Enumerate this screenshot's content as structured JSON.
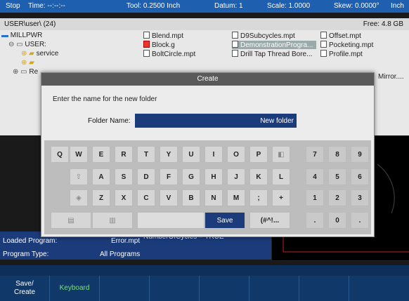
{
  "status": {
    "state": "Stop",
    "time": "Time: --:--:--",
    "tool": "Tool: 0.2500 Inch",
    "datum": "Datum: 1",
    "scale": "Scale: 1.0000",
    "skew": "Skew: 0.0000°",
    "units": "Inch"
  },
  "pathbar": {
    "path": "USER\\user\\ (24)",
    "free": "Free: 4.8 GB"
  },
  "tree": {
    "root": "MILLPWR",
    "user": "USER:",
    "service": "service",
    "re": "Re"
  },
  "files": {
    "col1": [
      "Blend.mpt",
      "Block.g",
      "BoltCircle.mpt"
    ],
    "col2": [
      "D9Subcycles.mpt",
      "DemonstrationProgra...",
      "Drill Tap Thread Bore..."
    ],
    "col3": [
      "Offset.mpt",
      "Pocketing.mpt",
      "Profile.mpt"
    ],
    "mirror": "Mirror...."
  },
  "info": {
    "loaded_label": "Loaded Program:",
    "loaded_value": "Error.mpt",
    "type_label": "Program Type:",
    "type_value": "All Programs",
    "code_line": "NumberOfCycles = TRUE"
  },
  "softkeys": [
    "Save/\nCreate",
    "Keyboard",
    "",
    "",
    "",
    "",
    "",
    ""
  ],
  "dialog": {
    "title": "Create",
    "prompt": "Enter the name for the new folder",
    "folder_label": "Folder Name:",
    "folder_value": "New folder",
    "row1": [
      "Q",
      "W",
      "E",
      "R",
      "T",
      "Y",
      "U",
      "I",
      "O",
      "P"
    ],
    "row2": [
      "A",
      "S",
      "D",
      "F",
      "G",
      "H",
      "J",
      "K",
      "L"
    ],
    "row3": [
      "Z",
      "X",
      "C",
      "V",
      "B",
      "N",
      "M",
      ";",
      "+"
    ],
    "num1": [
      "7",
      "8",
      "9"
    ],
    "num2": [
      "4",
      "5",
      "6"
    ],
    "num3": [
      "1",
      "2",
      "3"
    ],
    "num4": [
      ".",
      "0",
      "."
    ],
    "save_label": "Save",
    "symbols_label": "(#^!..."
  }
}
